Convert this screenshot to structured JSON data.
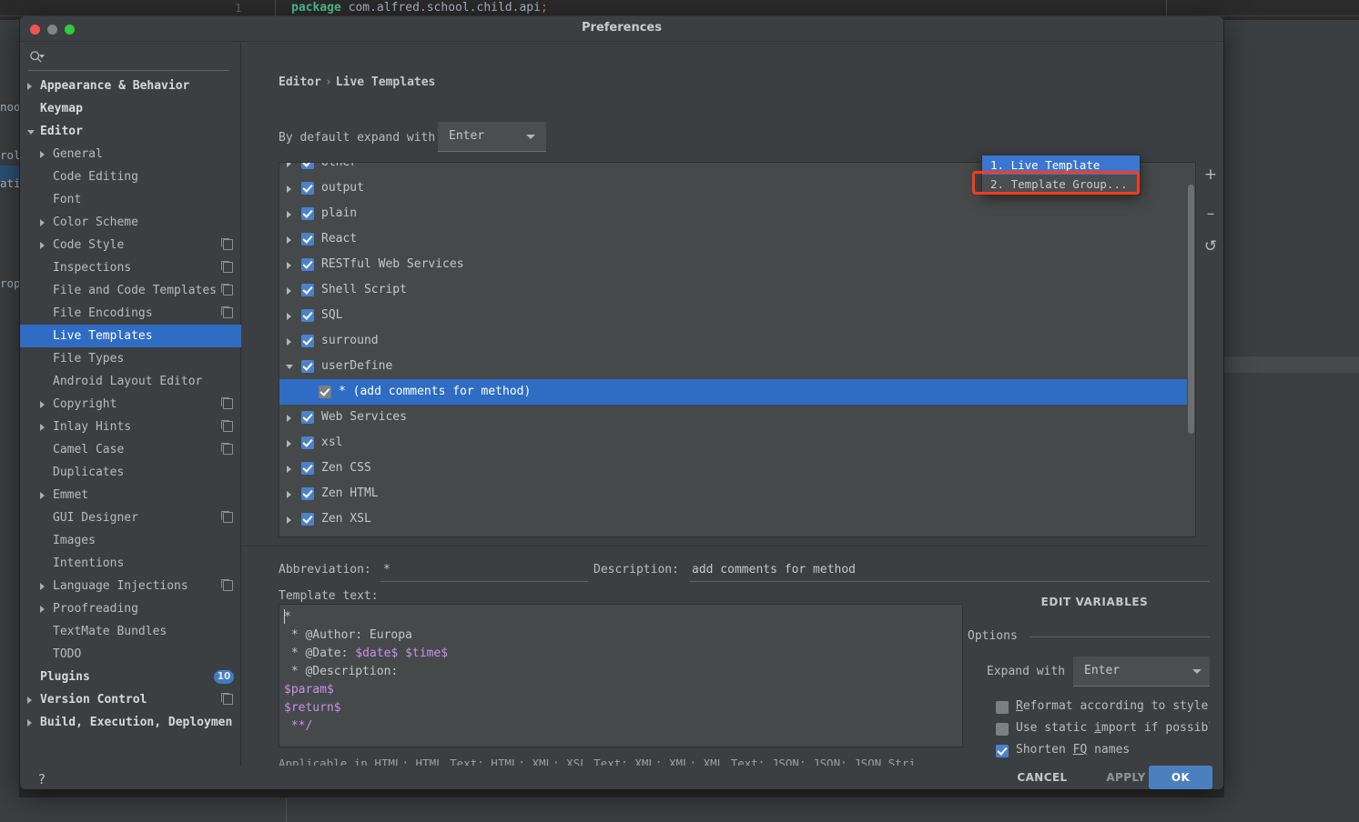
{
  "background": {
    "gutter_number": "1",
    "code_keyword": "package",
    "code_rest": " com.alfred.school.child.api",
    "code_semicolon": ";",
    "left_tool_fragments": [
      "noo",
      "rol",
      "ati",
      "rop"
    ],
    "status_text": ""
  },
  "dialog": {
    "title": "Preferences",
    "traffic_lights": {
      "close": "close-button",
      "minimize": "minimize-button",
      "maximize": "maximize-button"
    }
  },
  "sidebar": {
    "search": {
      "value": "",
      "placeholder": ""
    },
    "items": [
      {
        "label": "Appearance & Behavior",
        "level": 0,
        "arrow": "closed",
        "bold": true,
        "badge": null,
        "selected": false
      },
      {
        "label": "Keymap",
        "level": 0,
        "arrow": "none",
        "bold": true,
        "badge": null,
        "selected": false
      },
      {
        "label": "Editor",
        "level": 0,
        "arrow": "open",
        "bold": true,
        "badge": null,
        "selected": false
      },
      {
        "label": "General",
        "level": 1,
        "arrow": "closed",
        "bold": false,
        "badge": null,
        "selected": false
      },
      {
        "label": "Code Editing",
        "level": 1,
        "arrow": "none",
        "bold": false,
        "badge": null,
        "selected": false
      },
      {
        "label": "Font",
        "level": 1,
        "arrow": "none",
        "bold": false,
        "badge": null,
        "selected": false
      },
      {
        "label": "Color Scheme",
        "level": 1,
        "arrow": "closed",
        "bold": false,
        "badge": null,
        "selected": false
      },
      {
        "label": "Code Style",
        "level": 1,
        "arrow": "closed",
        "bold": false,
        "badge": "copy",
        "selected": false
      },
      {
        "label": "Inspections",
        "level": 1,
        "arrow": "none",
        "bold": false,
        "badge": "copy",
        "selected": false
      },
      {
        "label": "File and Code Templates",
        "level": 1,
        "arrow": "none",
        "bold": false,
        "badge": "copy",
        "selected": false
      },
      {
        "label": "File Encodings",
        "level": 1,
        "arrow": "none",
        "bold": false,
        "badge": "copy",
        "selected": false
      },
      {
        "label": "Live Templates",
        "level": 1,
        "arrow": "none",
        "bold": false,
        "badge": null,
        "selected": true
      },
      {
        "label": "File Types",
        "level": 1,
        "arrow": "none",
        "bold": false,
        "badge": null,
        "selected": false
      },
      {
        "label": "Android Layout Editor",
        "level": 1,
        "arrow": "none",
        "bold": false,
        "badge": null,
        "selected": false
      },
      {
        "label": "Copyright",
        "level": 1,
        "arrow": "closed",
        "bold": false,
        "badge": "copy",
        "selected": false
      },
      {
        "label": "Inlay Hints",
        "level": 1,
        "arrow": "closed",
        "bold": false,
        "badge": "copy",
        "selected": false
      },
      {
        "label": "Camel Case",
        "level": 1,
        "arrow": "none",
        "bold": false,
        "badge": "copy",
        "selected": false
      },
      {
        "label": "Duplicates",
        "level": 1,
        "arrow": "none",
        "bold": false,
        "badge": null,
        "selected": false
      },
      {
        "label": "Emmet",
        "level": 1,
        "arrow": "closed",
        "bold": false,
        "badge": null,
        "selected": false
      },
      {
        "label": "GUI Designer",
        "level": 1,
        "arrow": "none",
        "bold": false,
        "badge": "copy",
        "selected": false
      },
      {
        "label": "Images",
        "level": 1,
        "arrow": "none",
        "bold": false,
        "badge": null,
        "selected": false
      },
      {
        "label": "Intentions",
        "level": 1,
        "arrow": "none",
        "bold": false,
        "badge": null,
        "selected": false
      },
      {
        "label": "Language Injections",
        "level": 1,
        "arrow": "closed",
        "bold": false,
        "badge": "copy",
        "selected": false
      },
      {
        "label": "Proofreading",
        "level": 1,
        "arrow": "closed",
        "bold": false,
        "badge": null,
        "selected": false
      },
      {
        "label": "TextMate Bundles",
        "level": 1,
        "arrow": "none",
        "bold": false,
        "badge": null,
        "selected": false
      },
      {
        "label": "TODO",
        "level": 1,
        "arrow": "none",
        "bold": false,
        "badge": null,
        "selected": false
      },
      {
        "label": "Plugins",
        "level": 0,
        "arrow": "none",
        "bold": true,
        "badge": "10",
        "selected": false
      },
      {
        "label": "Version Control",
        "level": 0,
        "arrow": "closed",
        "bold": true,
        "badge": "copy",
        "selected": false
      },
      {
        "label": "Build, Execution, Deploymen",
        "level": 0,
        "arrow": "closed",
        "bold": true,
        "badge": null,
        "selected": false
      }
    ]
  },
  "main": {
    "breadcrumb": {
      "root": "Editor",
      "separator": "›",
      "leaf": "Live Templates"
    },
    "expand_with": {
      "label": "By default expand with",
      "value": "Enter"
    },
    "templates": [
      {
        "label": "other",
        "type": "group",
        "checked": true,
        "expanded": false,
        "selected": false
      },
      {
        "label": "output",
        "type": "group",
        "checked": true,
        "expanded": false,
        "selected": false
      },
      {
        "label": "plain",
        "type": "group",
        "checked": true,
        "expanded": false,
        "selected": false
      },
      {
        "label": "React",
        "type": "group",
        "checked": true,
        "expanded": false,
        "selected": false
      },
      {
        "label": "RESTful Web Services",
        "type": "group",
        "checked": true,
        "expanded": false,
        "selected": false
      },
      {
        "label": "Shell Script",
        "type": "group",
        "checked": true,
        "expanded": false,
        "selected": false
      },
      {
        "label": "SQL",
        "type": "group",
        "checked": true,
        "expanded": false,
        "selected": false
      },
      {
        "label": "surround",
        "type": "group",
        "checked": true,
        "expanded": false,
        "selected": false
      },
      {
        "label": "userDefine",
        "type": "group",
        "checked": true,
        "expanded": true,
        "selected": false
      },
      {
        "label": "* (add comments for method)",
        "type": "child",
        "checked": true,
        "expanded": false,
        "selected": true
      },
      {
        "label": "Web Services",
        "type": "group",
        "checked": true,
        "expanded": false,
        "selected": false
      },
      {
        "label": "xsl",
        "type": "group",
        "checked": true,
        "expanded": false,
        "selected": false
      },
      {
        "label": "Zen CSS",
        "type": "group",
        "checked": true,
        "expanded": false,
        "selected": false
      },
      {
        "label": "Zen HTML",
        "type": "group",
        "checked": true,
        "expanded": false,
        "selected": false
      },
      {
        "label": "Zen XSL",
        "type": "group",
        "checked": true,
        "expanded": false,
        "selected": false
      }
    ],
    "toolbar": {
      "add": "+",
      "remove": "–",
      "revert": "↺"
    },
    "popup": {
      "items": [
        {
          "label": "1. Live Template",
          "highlighted": true,
          "annotated": false
        },
        {
          "label": "2. Template Group...",
          "highlighted": false,
          "annotated": true
        }
      ],
      "annotation_color": "#ff3a1d"
    }
  },
  "detail": {
    "abbreviation": {
      "label": "Abbreviation:",
      "value": "*"
    },
    "description": {
      "label": "Description:",
      "value": "add comments for method"
    },
    "template_text_label": "Template text:",
    "template_lines": [
      [
        {
          "t": "*",
          "k": "plain"
        }
      ],
      [
        {
          "t": " * @Author: Europa",
          "k": "plain"
        }
      ],
      [
        {
          "t": " * @Date: ",
          "k": "plain"
        },
        {
          "t": "$date$",
          "k": "var"
        },
        {
          "t": " ",
          "k": "plain"
        },
        {
          "t": "$time$",
          "k": "var"
        }
      ],
      [
        {
          "t": " * @Description:",
          "k": "plain"
        }
      ],
      [
        {
          "t": "$param$",
          "k": "var"
        }
      ],
      [
        {
          "t": "$return$",
          "k": "var"
        }
      ],
      [
        {
          "t": " ",
          "k": "plain"
        },
        {
          "t": "**/",
          "k": "var"
        }
      ]
    ],
    "applicable": "Applicable in HTML: HTML Text; HTML; XML: XSL Text; XML; XML: XML Text; JSON; JSON: JSON Stri...",
    "edit_variables": "EDIT VARIABLES",
    "options_title": "Options",
    "expand_with": {
      "label": "Expand with",
      "value": "Enter"
    },
    "checkboxes": [
      {
        "pre": "",
        "mnemonic": "R",
        "post": "eformat according to style",
        "checked": false
      },
      {
        "pre": "Use static ",
        "mnemonic": "i",
        "post": "mport if possible",
        "checked": false
      },
      {
        "pre": "Shorten ",
        "mnemonic": "FQ",
        "post": " names",
        "checked": true
      }
    ]
  },
  "footer": {
    "help": "?",
    "cancel": "CANCEL",
    "apply": "APPLY",
    "ok": "OK"
  },
  "colors": {
    "accent_blue": "#2f6cc4",
    "checkbox_blue": "#4b82c9",
    "annotation_red": "#ff3a1d",
    "variable_purple": "#c792ea",
    "keyword_green": "#4fc08d",
    "badge_blue": "#3f7dc4"
  }
}
